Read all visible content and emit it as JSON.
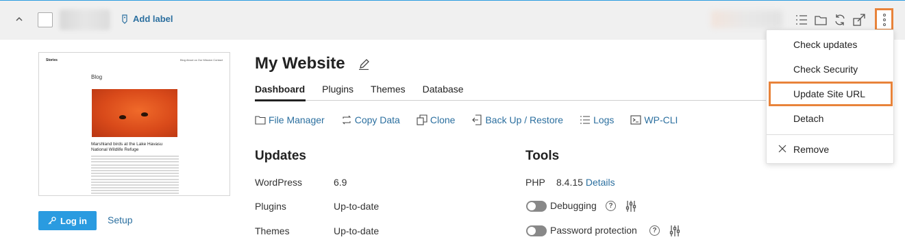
{
  "header": {
    "add_label": "Add label"
  },
  "thumbnail": {
    "site_name": "Stories",
    "nav": "Blog   About us   Our Mission   Contact",
    "heading": "Blog",
    "caption": "Marshland birds at the Lake Havasu National Wildlife Refuge"
  },
  "site": {
    "title": "My Website",
    "login_label": "Log in",
    "setup_label": "Setup"
  },
  "tabs": [
    "Dashboard",
    "Plugins",
    "Themes",
    "Database"
  ],
  "actions": [
    {
      "label": "File Manager",
      "icon": "folder-icon"
    },
    {
      "label": "Copy Data",
      "icon": "copy-data-icon"
    },
    {
      "label": "Clone",
      "icon": "clone-icon"
    },
    {
      "label": "Back Up / Restore",
      "icon": "backup-icon"
    },
    {
      "label": "Logs",
      "icon": "logs-icon"
    },
    {
      "label": "WP-CLI",
      "icon": "terminal-icon"
    }
  ],
  "updates": {
    "title": "Updates",
    "rows": [
      {
        "label": "WordPress",
        "value": "6.9"
      },
      {
        "label": "Plugins",
        "value": "Up-to-date"
      },
      {
        "label": "Themes",
        "value": "Up-to-date"
      }
    ]
  },
  "tools": {
    "title": "Tools",
    "php_label": "PHP",
    "php_version": "8.4.15",
    "php_details": "Details",
    "debugging_label": "Debugging",
    "password_label": "Password protection"
  },
  "menu": {
    "items": [
      "Check updates",
      "Check Security",
      "Update Site URL",
      "Detach"
    ],
    "remove_label": "Remove"
  },
  "colors": {
    "accent": "#2a9be0",
    "link": "#2b6f9f",
    "highlight": "#e8833a"
  }
}
